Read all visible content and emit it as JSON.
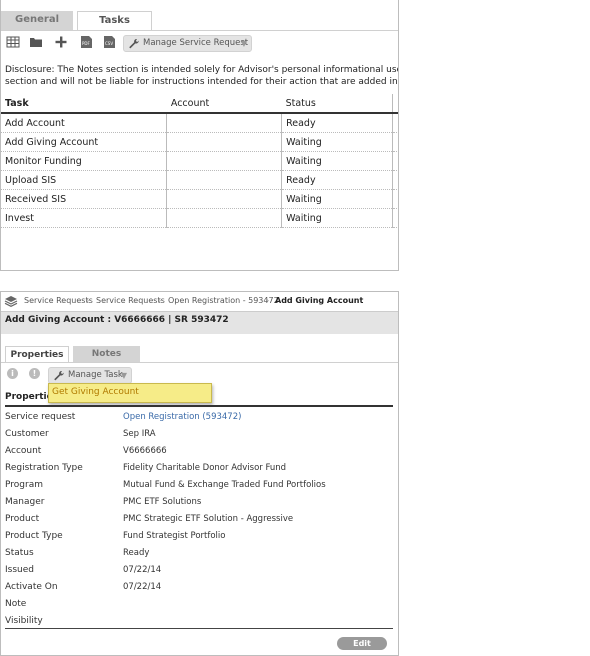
{
  "tabs": {
    "general": "General",
    "tasks": "Tasks"
  },
  "toolbar": {
    "icons": [
      "spreadsheet-icon",
      "folder-icon",
      "add-icon",
      "pdf-icon",
      "csv-icon"
    ],
    "manage": "Manage Service Request"
  },
  "disclosure": {
    "line1": "Disclosure: The Notes section is intended solely for Advisor's personal informational use and sl",
    "line2": "section and will not be liable for instructions intended for their action that are added in this sec"
  },
  "task_table": {
    "headers": [
      "Task",
      "Account",
      "Status"
    ],
    "rows": [
      {
        "task": "Add Account",
        "account": "",
        "status": "Ready"
      },
      {
        "task": "Add Giving Account",
        "account": "",
        "status": "Waiting"
      },
      {
        "task": "Monitor Funding",
        "account": "",
        "status": "Waiting"
      },
      {
        "task": "Upload SIS",
        "account": "",
        "status": "Ready"
      },
      {
        "task": "Received SIS",
        "account": "",
        "status": "Waiting"
      },
      {
        "task": "Invest",
        "account": "",
        "status": "Waiting"
      }
    ]
  },
  "breadcrumb": [
    "Service Requests",
    "Service Requests",
    "Open Registration - 593472",
    "Add Giving Account"
  ],
  "header_title": "Add Giving Account : V6666666  |  SR 593472",
  "detail_tabs": {
    "properties": "Properties",
    "notes": "Notes"
  },
  "manage_task": "Manage Task",
  "menu_item": "Get Giving Account",
  "properties_heading": "Properties",
  "properties": [
    {
      "key": "Service request",
      "value": "Open Registration (593472)",
      "link": true
    },
    {
      "key": "Customer",
      "value": "Sep IRA"
    },
    {
      "key": "Account",
      "value": "V6666666"
    },
    {
      "key": "Registration Type",
      "value": "Fidelity Charitable Donor Advisor Fund"
    },
    {
      "key": "Program",
      "value": "Mutual Fund & Exchange Traded Fund Portfolios"
    },
    {
      "key": "Manager",
      "value": "PMC ETF Solutions"
    },
    {
      "key": "Product",
      "value": "PMC Strategic ETF Solution - Aggressive"
    },
    {
      "key": "Product Type",
      "value": "Fund Strategist Portfolio"
    },
    {
      "key": "Status",
      "value": "Ready"
    },
    {
      "key": "Issued",
      "value": "07/22/14"
    },
    {
      "key": "Activate On",
      "value": "07/22/14"
    },
    {
      "key": "Note",
      "value": ""
    },
    {
      "key": "Visibility",
      "value": ""
    }
  ],
  "edit_label": "Edit"
}
